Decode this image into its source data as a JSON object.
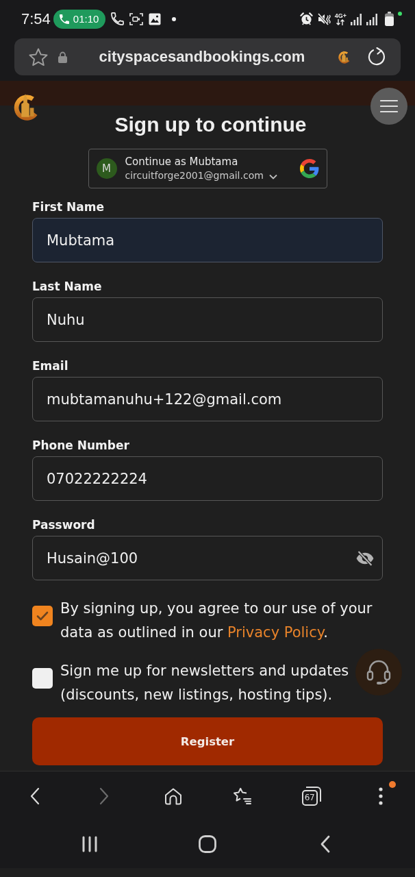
{
  "status_bar": {
    "time": "7:54",
    "call_timer": "01:10",
    "network_type": "4G+"
  },
  "browser_bar": {
    "url": "cityspacesandbookings.com"
  },
  "form": {
    "title": "Sign up to continue",
    "google_account": {
      "avatar_letter": "M",
      "heading": "Continue as Mubtama",
      "email": "circuitforge2001@gmail.com"
    },
    "fields": [
      {
        "kind": "text",
        "label": "First Name",
        "value": "Mubtama",
        "autofilled": true
      },
      {
        "kind": "text",
        "label": "Last Name",
        "value": "Nuhu",
        "autofilled": false
      },
      {
        "kind": "text",
        "label": "Email",
        "value": "mubtamanuhu+122@gmail.com",
        "autofilled": false
      },
      {
        "kind": "text",
        "label": "Phone Number",
        "value": "07022222224",
        "autofilled": false
      },
      {
        "kind": "password",
        "label": "Password",
        "value": "Husain@100",
        "autofilled": false
      }
    ],
    "consents": [
      {
        "text": "By signing up, you agree to our use of your data as outlined in our ",
        "link": "Privacy Policy",
        "text_after": ".",
        "checked": true
      },
      {
        "text": "Sign me up for newsletters and updates (discounts, new listings, hosting tips).",
        "checked": false
      }
    ],
    "submit_button": "Register"
  },
  "browser_toolbar": [
    {
      "kind": "back",
      "disabled": false
    },
    {
      "kind": "forward",
      "disabled": true
    },
    {
      "kind": "home",
      "disabled": false
    },
    {
      "kind": "bookmarks",
      "disabled": false
    },
    {
      "kind": "tabs",
      "count": "67",
      "disabled": false
    },
    {
      "kind": "more",
      "badge": true,
      "disabled": false
    }
  ]
}
